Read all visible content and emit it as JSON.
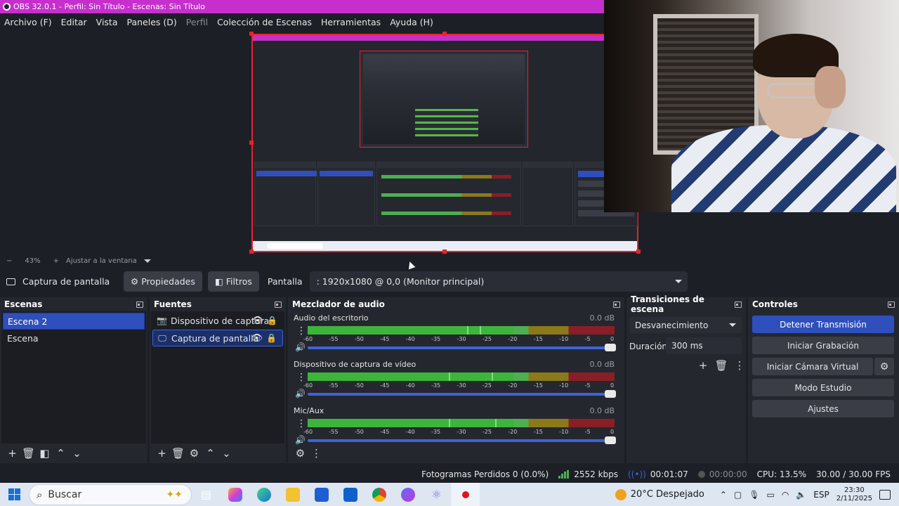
{
  "window": {
    "title": "OBS 32.0.1 - Perfil: Sin Título - Escenas: Sin Título"
  },
  "menu": [
    "Archivo (F)",
    "Editar",
    "Vista",
    "Paneles (D)",
    "Perfil",
    "Colección de Escenas",
    "Herramientas",
    "Ayuda (H)"
  ],
  "zoom": {
    "minus": "−",
    "level": "43%",
    "plus": "+",
    "fit": "Ajustar a la ventana"
  },
  "source_toolbar": {
    "source_name": "Captura de pantalla",
    "properties": "Propiedades",
    "filters": "Filtros",
    "display_label": "Pantalla",
    "display_value": ": 1920x1080 @ 0,0 (Monitor principal)"
  },
  "scenes": {
    "title": "Escenas",
    "items": [
      "Escena 2",
      "Escena"
    ],
    "selected": 0
  },
  "sources": {
    "title": "Fuentes",
    "items": [
      {
        "label": "Dispositivo de captura",
        "icon": "camera-icon"
      },
      {
        "label": "Captura de pantalla",
        "icon": "monitor-icon"
      }
    ],
    "selected": 1
  },
  "mixer": {
    "title": "Mezclador de audio",
    "channels": [
      {
        "name": "Audio del escritorio",
        "db": "0.0 dB",
        "level": 0.56
      },
      {
        "name": "Dispositivo de captura de vídeo",
        "db": "0.0 dB",
        "level": 0.6
      },
      {
        "name": "Mic/Aux",
        "db": "0.0 dB",
        "level": 0.6
      }
    ],
    "scale": [
      "-60",
      "-55",
      "-50",
      "-45",
      "-40",
      "-35",
      "-30",
      "-25",
      "-20",
      "-15",
      "-10",
      "-5",
      "0"
    ]
  },
  "transitions": {
    "title": "Transiciones de escena",
    "type": "Desvanecimiento",
    "duration_label": "Duración",
    "duration": "300 ms"
  },
  "controls": {
    "title": "Controles",
    "stop_stream": "Detener Transmisión",
    "start_recording": "Iniciar Grabación",
    "start_virtual_cam": "Iniciar Cámara Virtual",
    "studio_mode": "Modo Estudio",
    "settings": "Ajustes"
  },
  "status": {
    "dropped": "Fotogramas Perdidos 0 (0.0%)",
    "bitrate": "2552 kbps",
    "stream_time": "00:01:07",
    "rec_time": "00:00:00",
    "cpu": "CPU: 13.5%",
    "fps": "30.00 / 30.00 FPS"
  },
  "taskbar": {
    "search": "Buscar",
    "weather": "20°C  Despejado",
    "lang": "ESP",
    "time": "23:30",
    "date": "2/11/2025"
  },
  "colors": {
    "accent": "#2f4fbd",
    "titlebar": "#c62fce",
    "recording_border": "#e8222b"
  }
}
